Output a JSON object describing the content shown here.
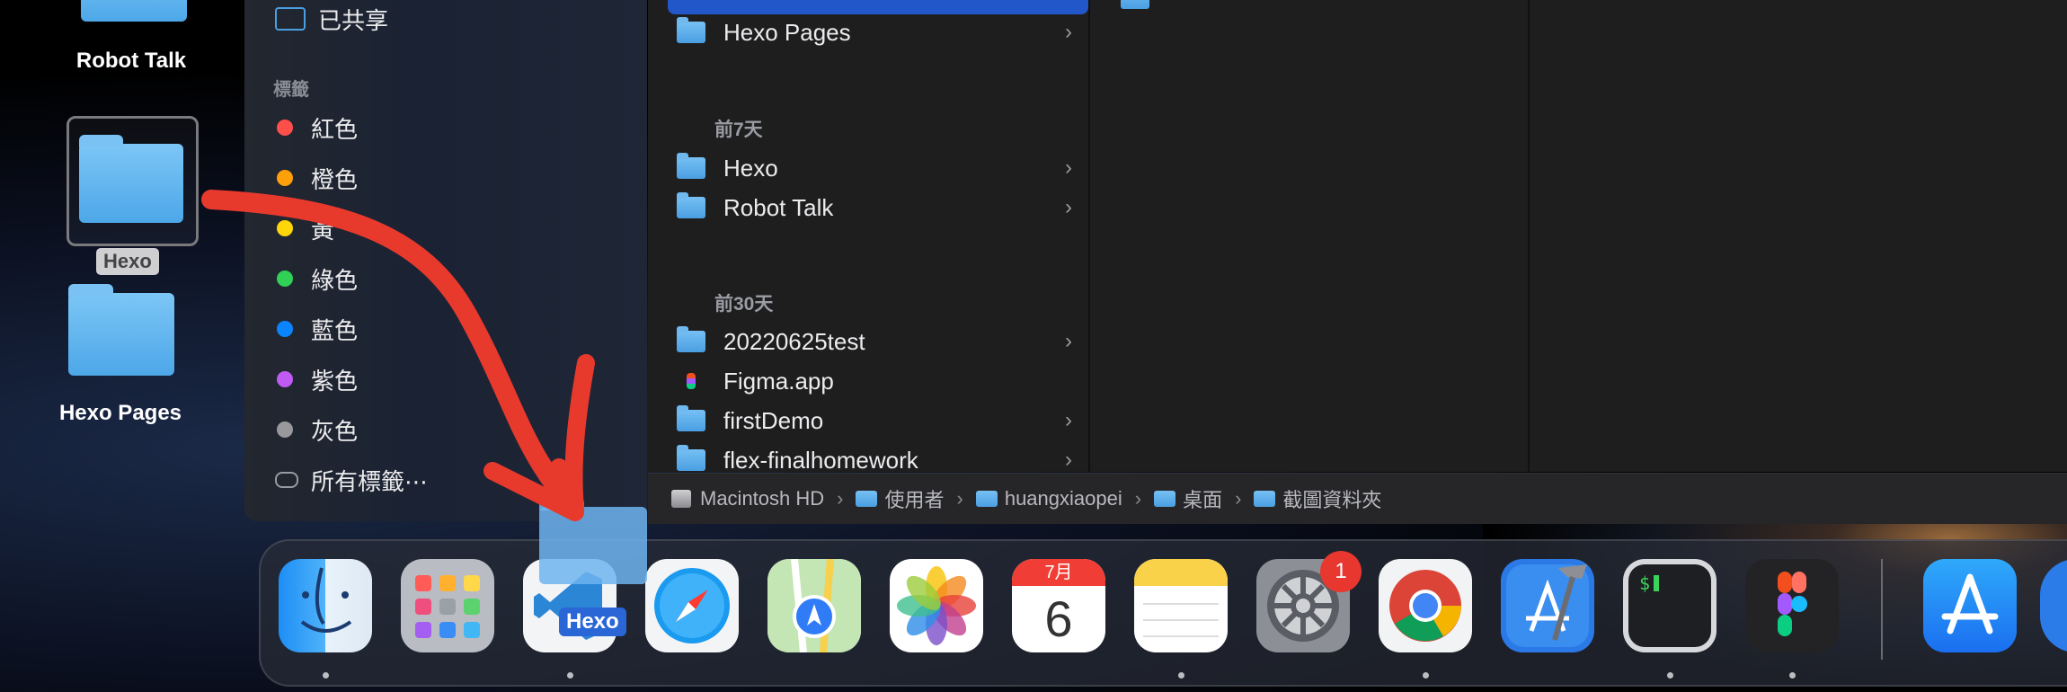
{
  "desktop": {
    "icons": [
      {
        "label": "Robot Talk"
      },
      {
        "label": "Hexo"
      },
      {
        "label": "Hexo Pages"
      }
    ]
  },
  "sidebar": {
    "shared_label": "已共享",
    "tags_header": "標籤",
    "tags": [
      {
        "label": "紅色",
        "color": "#ff4f4a"
      },
      {
        "label": "橙色",
        "color": "#ff9f0a"
      },
      {
        "label": "黃",
        "color": "#ffd60a"
      },
      {
        "label": "綠色",
        "color": "#31d158"
      },
      {
        "label": "藍色",
        "color": "#0a84ff"
      },
      {
        "label": "紫色",
        "color": "#bf5af2"
      },
      {
        "label": "灰色",
        "color": "#98989d"
      }
    ],
    "all_tags_label": "所有標籤⋯"
  },
  "finder": {
    "column1": {
      "top_items": [
        {
          "label": "Hexo Pages"
        }
      ],
      "groups": [
        {
          "header": "前7天",
          "items": [
            {
              "label": "Hexo"
            },
            {
              "label": "Robot Talk"
            }
          ]
        },
        {
          "header": "前30天",
          "items": [
            {
              "label": "20220625test"
            },
            {
              "label": "Figma.app"
            },
            {
              "label": "firstDemo"
            },
            {
              "label": "flex-finalhomework"
            }
          ]
        }
      ]
    },
    "path_bar": [
      "Macintosh HD",
      "使用者",
      "huangxiaopei",
      "桌面",
      "截圖資料夾"
    ]
  },
  "dock": {
    "apps": [
      {
        "name": "Finder"
      },
      {
        "name": "Launchpad"
      },
      {
        "name": "Visual Studio Code"
      },
      {
        "name": "Safari"
      },
      {
        "name": "Maps"
      },
      {
        "name": "Photos"
      },
      {
        "name": "Calendar",
        "month": "7月",
        "day": "6"
      },
      {
        "name": "Notes"
      },
      {
        "name": "System Preferences",
        "badge": "1"
      },
      {
        "name": "Google Chrome"
      },
      {
        "name": "Xcode"
      },
      {
        "name": "Terminal"
      },
      {
        "name": "Figma"
      },
      {
        "name": "App Store"
      }
    ],
    "drag_label": "Hexo"
  },
  "annotation": {
    "color": "#e8392d"
  }
}
